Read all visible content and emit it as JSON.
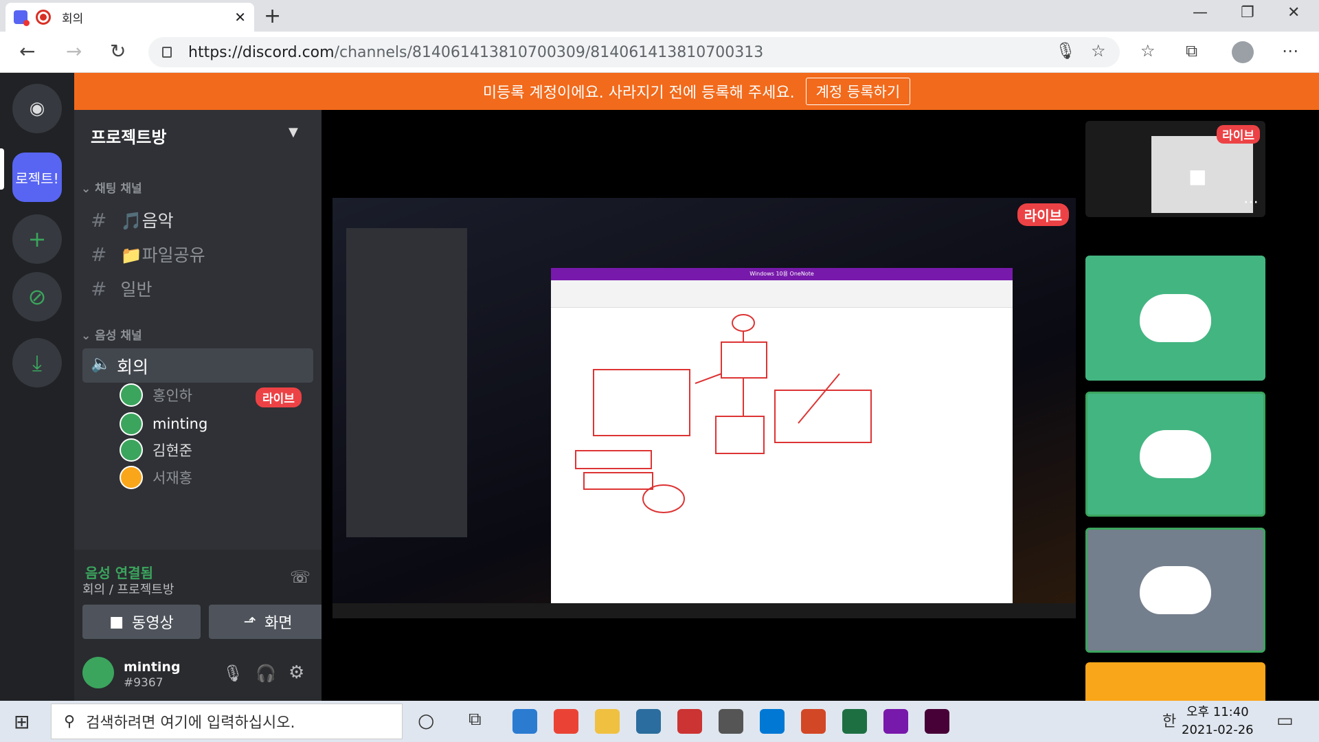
{
  "browser": {
    "tab_title": "회의",
    "tab_close": "✕",
    "new_tab": "+",
    "url_host": "https://discord.com",
    "url_path": "/channels/814061413810700309/814061413810700313",
    "minimize": "—",
    "restore": "❐",
    "close": "✕"
  },
  "banner": {
    "text": "미등록 계정이에요. 사라지기 전에 등록해 주세요.",
    "button": "계정 등록하기"
  },
  "server": {
    "name": "프로젝트방",
    "icon_label": "로젝트!"
  },
  "channels": {
    "text_category": "채팅 채널",
    "text": [
      {
        "label": "🎵음악"
      },
      {
        "label": "📁파일공유"
      },
      {
        "label": "일반"
      }
    ],
    "voice_category": "음성 채널",
    "voice_channel": "회의",
    "users": [
      {
        "name": "홍인하",
        "color": "#3ba55d"
      },
      {
        "name": "minting",
        "color": "#3ba55d"
      },
      {
        "name": "김현준",
        "color": "#3ba55d"
      },
      {
        "name": "서재홍",
        "color": "#faa61a"
      }
    ],
    "live": "라이브"
  },
  "panel": {
    "status": "음성 연결됨",
    "sub": "회의 / 프로젝트방",
    "video_btn": "동영상",
    "screen_btn": "화면",
    "username": "minting",
    "tag": "#9367"
  },
  "stage": {
    "live": "라이브",
    "preview_live": "라이브",
    "onenote_title": "Windows 10용 OneNote"
  },
  "os": {
    "search_placeholder": "검색하려면 여기에 입력하십시오.",
    "ampm_time": "오후 11:40",
    "date": "2021-02-26",
    "ime": "한"
  },
  "colors": {
    "blurple": "#5865f2",
    "green": "#3ba55d",
    "orange": "#f26a1b",
    "red": "#ed4245",
    "gold": "#faa61a",
    "grey_tile": "#747f8d"
  }
}
